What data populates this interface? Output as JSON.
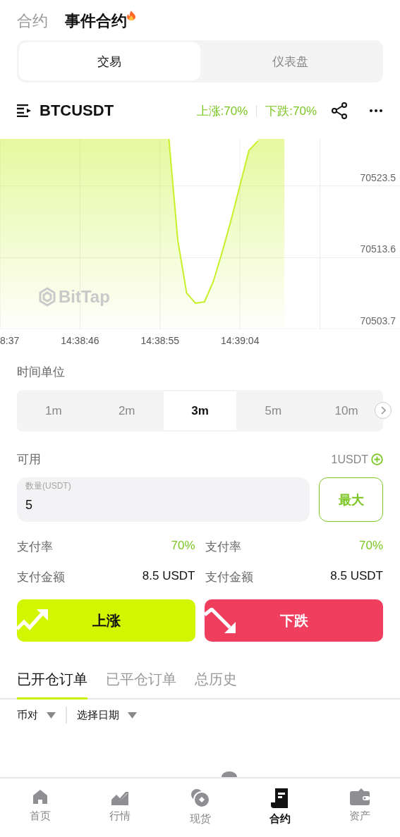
{
  "header": {
    "tabs": [
      {
        "label": "合约",
        "selected": false
      },
      {
        "label": "事件合约",
        "selected": true,
        "hot": true
      }
    ]
  },
  "mode_tabs": [
    {
      "label": "交易",
      "selected": true
    },
    {
      "label": "仪表盘",
      "selected": false
    }
  ],
  "symbol_bar": {
    "symbol": "BTCUSDT",
    "up_rate": "上涨:70%",
    "down_rate": "下跌:70%"
  },
  "chart": {
    "watermark": "BitTap",
    "chart_data": {
      "type": "line",
      "grid": true,
      "ylim": [
        70503.7,
        70530.0
      ],
      "categories": [
        "8:37",
        null,
        null,
        null,
        null,
        null,
        null,
        null,
        null,
        "14:38:46",
        null,
        null,
        null,
        null,
        null,
        null,
        null,
        null,
        "14:38:55",
        null,
        null,
        null,
        null,
        null,
        null,
        null,
        null,
        "14:39:04",
        null,
        null,
        null,
        null,
        null,
        null,
        null,
        null,
        null,
        null,
        null,
        null,
        null,
        null,
        null,
        null,
        null,
        null
      ],
      "yticks": [
        70523.5,
        70513.6,
        70503.7
      ],
      "series": [
        {
          "color": "#c8f02a",
          "values": [
            null,
            null,
            null,
            null,
            null,
            null,
            null,
            null,
            null,
            null,
            null,
            null,
            null,
            null,
            null,
            null,
            null,
            null,
            null,
            70530.0,
            70516.0,
            70508.7,
            70507.3,
            70507.5,
            70510.3,
            70514.4,
            70518.8,
            70523.6,
            70528.4,
            70529.7,
            null,
            null,
            null,
            null,
            null,
            null,
            null,
            null,
            null,
            null,
            null,
            null,
            null,
            null,
            null,
            null
          ]
        }
      ]
    }
  },
  "time_unit": {
    "label": "时间单位",
    "options": [
      {
        "label": "1m",
        "selected": false
      },
      {
        "label": "2m",
        "selected": false
      },
      {
        "label": "3m",
        "selected": true
      },
      {
        "label": "5m",
        "selected": false
      },
      {
        "label": "10m",
        "selected": false
      }
    ]
  },
  "balance": {
    "label": "可用",
    "value": "1USDT"
  },
  "amount": {
    "placeholder": "数量(USDT)",
    "value": "5",
    "max_button": "最大"
  },
  "payout": [
    {
      "rate_label": "支付率",
      "rate": "70%",
      "amount_label": "支付金额",
      "amount": "8.5 USDT"
    },
    {
      "rate_label": "支付率",
      "rate": "70%",
      "amount_label": "支付金额",
      "amount": "8.5 USDT"
    }
  ],
  "actions": [
    {
      "kind": "up",
      "label": "上涨"
    },
    {
      "kind": "down",
      "label": "下跌"
    }
  ],
  "order_tabs": [
    {
      "label": "已开仓订单",
      "selected": true
    },
    {
      "label": "已平仓订单",
      "selected": false
    },
    {
      "label": "总历史",
      "selected": false
    }
  ],
  "filters": [
    {
      "label": "币对"
    },
    {
      "label": "选择日期"
    }
  ],
  "bottom_nav": [
    {
      "kind": "home",
      "label": "首页",
      "selected": false
    },
    {
      "kind": "market",
      "label": "行情",
      "selected": false
    },
    {
      "kind": "spot",
      "label": "现货",
      "selected": false
    },
    {
      "kind": "contract",
      "label": "合约",
      "selected": true
    },
    {
      "kind": "assets",
      "label": "资产",
      "selected": false
    }
  ]
}
